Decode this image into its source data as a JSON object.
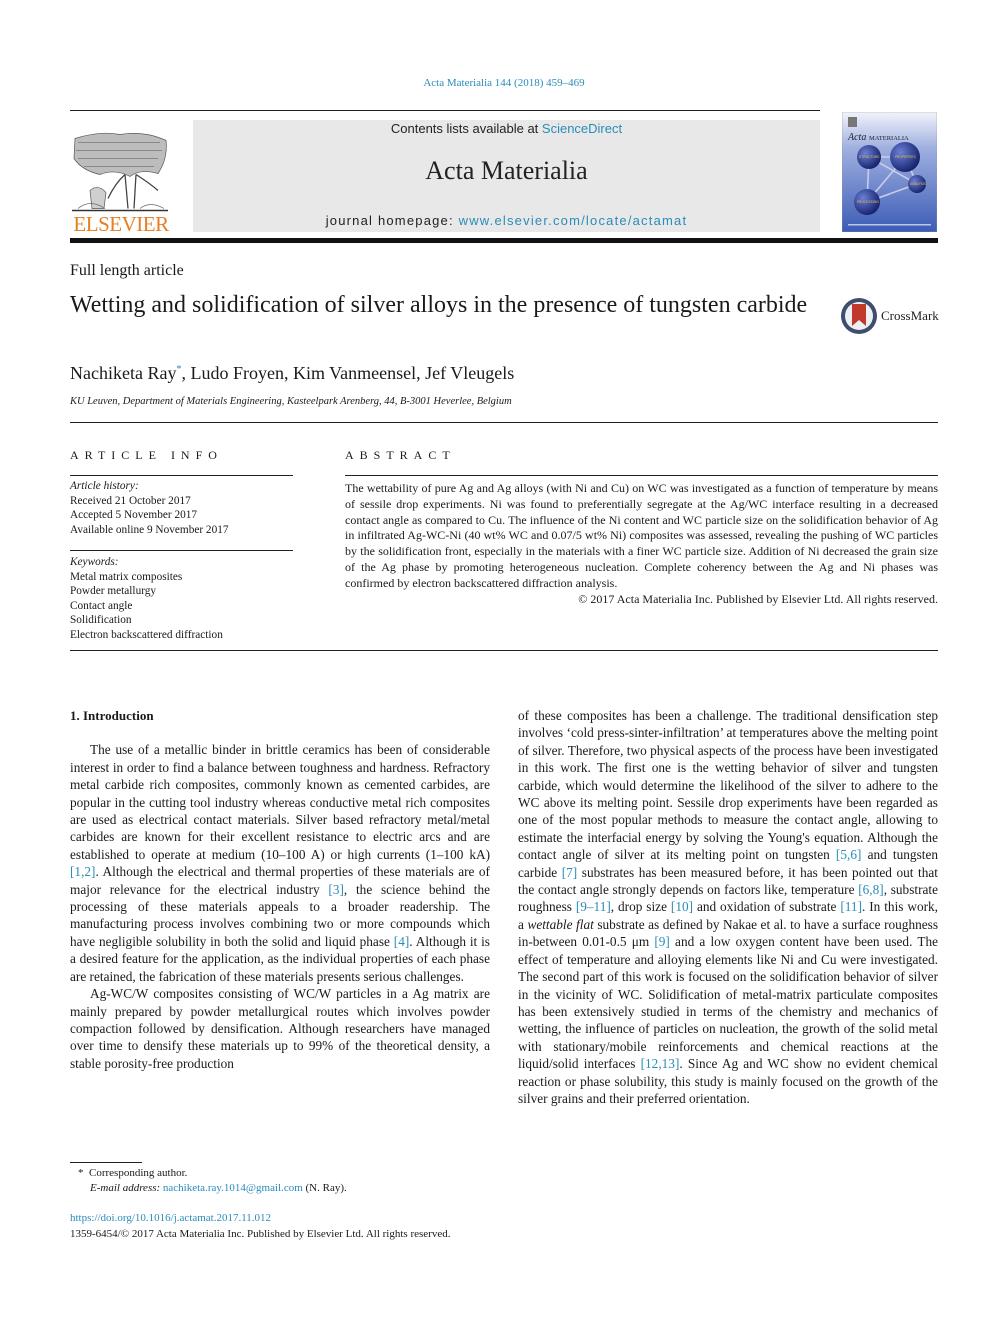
{
  "header": {
    "journal_ref": "Acta Materialia 144 (2018) 459–469",
    "contents_prefix": "Contents lists available at ",
    "contents_link": "ScienceDirect",
    "journal_name": "Acta Materialia",
    "homepage_prefix": "journal homepage: ",
    "homepage_link": "www.elsevier.com/locate/actamat",
    "publisher_logo_text": "ELSEVIER",
    "cover_title_italic": "Acta",
    "cover_title": "MATERIALIA",
    "cover_nodes": [
      "STRUCTURE",
      "PROPERTIES",
      "ANALYSIS",
      "PROCESSING"
    ],
    "crossmark_label": "CrossMark"
  },
  "colors": {
    "link": "#2a8cb8",
    "elsevier_orange": "#e67e22",
    "header_band": "#e8e8e8",
    "cover_blue": "#3b5bb5",
    "crossmark_red": "#c0392b"
  },
  "article": {
    "type": "Full length article",
    "title": "Wetting and solidification of silver alloys in the presence of tungsten carbide",
    "authors": [
      {
        "name": "Nachiketa Ray",
        "mark": "*"
      },
      {
        "name": "Ludo Froyen",
        "mark": ""
      },
      {
        "name": "Kim Vanmeensel",
        "mark": ""
      },
      {
        "name": "Jef Vleugels",
        "mark": ""
      }
    ],
    "affiliation": "KU Leuven, Department of Materials Engineering, Kasteelpark Arenberg, 44, B-3001 Heverlee, Belgium"
  },
  "article_info": {
    "heading": "ARTICLE INFO",
    "history_label": "Article history:",
    "history": [
      "Received 21 October 2017",
      "Accepted 5 November 2017",
      "Available online 9 November 2017"
    ],
    "keywords_label": "Keywords:",
    "keywords": [
      "Metal matrix composites",
      "Powder metallurgy",
      "Contact angle",
      "Solidification",
      "Electron backscattered diffraction"
    ]
  },
  "abstract": {
    "heading": "ABSTRACT",
    "text": "The wettability of pure Ag and Ag alloys (with Ni and Cu) on WC was investigated as a function of temperature by means of sessile drop experiments. Ni was found to preferentially segregate at the Ag/WC interface resulting in a decreased contact angle as compared to Cu. The influence of the Ni content and WC particle size on the solidification behavior of Ag in infiltrated Ag-WC-Ni (40 wt% WC and 0.07/5 wt% Ni) composites was assessed, revealing the pushing of WC particles by the solidification front, especially in the materials with a finer WC particle size. Addition of Ni decreased the grain size of the Ag phase by promoting heterogeneous nucleation. Complete coherency between the Ag and Ni phases was confirmed by electron backscattered diffraction analysis.",
    "copyright": "© 2017 Acta Materialia Inc. Published by Elsevier Ltd. All rights reserved."
  },
  "body": {
    "section_heading": "1.  Introduction",
    "left": {
      "p1": [
        {
          "t": "The use of a metallic binder in brittle ceramics has been of considerable interest in order to find a balance between toughness and hardness. Refractory metal carbide rich composites, commonly known as cemented carbides, are popular in the cutting tool industry whereas conductive metal rich composites are used as electrical contact materials. Silver based refractory metal/metal carbides are known for their excellent resistance to electric arcs and are established to operate at medium (10–100 A) or high currents (1–100 kA) "
        },
        {
          "ref": "[1,2]"
        },
        {
          "t": ". Although the electrical and thermal properties of these materials are of major relevance for the electrical industry "
        },
        {
          "ref": "[3]"
        },
        {
          "t": ", the science behind the processing of these materials appeals to a broader readership. The manufacturing process involves combining two or more compounds which have negligible solubility in both the solid and liquid phase "
        },
        {
          "ref": "[4]"
        },
        {
          "t": ". Although it is a desired feature for the application, as the individual properties of each phase are retained, the fabrication of these materials presents serious challenges."
        }
      ],
      "p2": [
        {
          "t": "Ag-WC/W composites consisting of WC/W particles in a Ag matrix are mainly prepared by powder metallurgical routes which involves powder compaction followed by densification. Although researchers have managed over time to densify these materials up to 99% of the theoretical density, a stable porosity-free production"
        }
      ]
    },
    "right": {
      "p1": [
        {
          "t": "of these composites has been a challenge. The traditional densification step involves ‘cold press-sinter-infiltration’ at temperatures above the melting point of silver. Therefore, two physical aspects of the process have been investigated in this work. The first one is the wetting behavior of silver and tungsten carbide, which would determine the likelihood of the silver to adhere to the WC above its melting point. Sessile drop experiments have been regarded as one of the most popular methods to measure the contact angle, allowing to estimate the interfacial energy by solving the Young's equation. Although the contact angle of silver at its melting point on tungsten "
        },
        {
          "ref": "[5,6]"
        },
        {
          "t": " and tungsten carbide "
        },
        {
          "ref": "[7]"
        },
        {
          "t": " substrates has been measured before, it has been pointed out that the contact angle strongly depends on factors like, temperature "
        },
        {
          "ref": "[6,8]"
        },
        {
          "t": ", substrate roughness "
        },
        {
          "ref": "[9–11]"
        },
        {
          "t": ", drop size "
        },
        {
          "ref": "[10]"
        },
        {
          "t": " and oxidation of substrate "
        },
        {
          "ref": "[11]"
        },
        {
          "t": ". In this work, a "
        },
        {
          "i": "wettable flat"
        },
        {
          "t": " substrate as defined by Nakae et al. to have a surface roughness in-between 0.01-0.5 μm "
        },
        {
          "ref": "[9]"
        },
        {
          "t": " and a low oxygen content have been used. The effect of temperature and alloying elements like Ni and Cu were investigated. The second part of this work is focused on the solidification behavior of silver in the vicinity of WC. Solidification of metal-matrix particulate composites has been extensively studied in terms of the chemistry and mechanics of wetting, the influence of particles on nucleation, the growth of the solid metal with stationary/mobile reinforcements and chemical reactions at the liquid/solid interfaces "
        },
        {
          "ref": "[12,13]"
        },
        {
          "t": ". Since Ag and WC show no evident chemical reaction or phase solubility, this study is mainly focused on the growth of the silver grains and their preferred orientation."
        }
      ]
    }
  },
  "footnote": {
    "mark": "*",
    "corresponding": "Corresponding author.",
    "email_label": "E-mail address:",
    "email": "nachiketa.ray.1014@gmail.com",
    "email_suffix": "(N. Ray)."
  },
  "footer": {
    "doi": "https://doi.org/10.1016/j.actamat.2017.11.012",
    "issn_copyright": "1359-6454/© 2017 Acta Materialia Inc. Published by Elsevier Ltd. All rights reserved."
  }
}
